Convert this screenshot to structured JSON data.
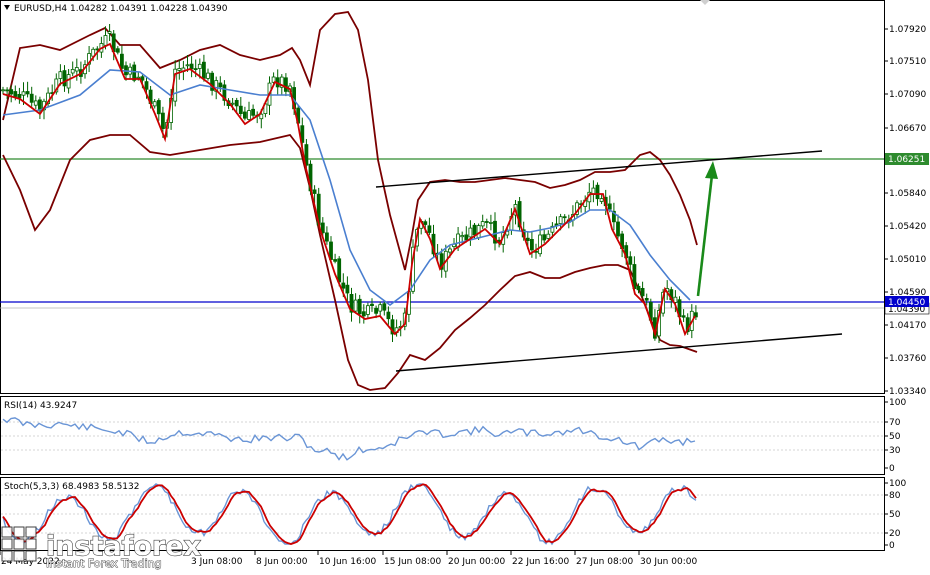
{
  "main_chart": {
    "symbol_header": "EURUSD,H4  1.04282 1.04391 1.04228 1.04390",
    "price_levels": [
      "1.07920",
      "1.07510",
      "1.07090",
      "1.06670",
      "1.05840",
      "1.05420",
      "1.05010",
      "1.04590",
      "1.04170",
      "1.03760",
      "1.03340"
    ],
    "tags": {
      "green_level": "1.06251",
      "blue_level": "1.04450",
      "current_price": "1.04390"
    },
    "colors": {
      "candles": "#006400",
      "red_ma": "#cc0000",
      "blue_ma": "#4a7fd0",
      "bollinger": "#7a0000",
      "green_line": "#2e8b2e",
      "blue_line": "#0000cc",
      "trend_lines": "#000000",
      "arrow": "#1a8a1a"
    }
  },
  "rsi_panel": {
    "title": "RSI(14) 43.9247",
    "levels": [
      "100",
      "70",
      "50",
      "30",
      "0"
    ]
  },
  "stoch_panel": {
    "title": "Stoch(5,3,3) 68.4983 58.5132",
    "levels": [
      "100",
      "80",
      "50",
      "20",
      "0"
    ]
  },
  "x_axis": [
    "24 May 2022",
    "3 Jun 08:00",
    "8 Jun 00:00",
    "10 Jun 16:00",
    "15 Jun 08:00",
    "20 Jun 00:00",
    "22 Jun 16:00",
    "27 Jun 08:00",
    "30 Jun 00:00"
  ],
  "watermark": {
    "brand": "instaforex",
    "tagline": "Instant Forex Trading"
  }
}
